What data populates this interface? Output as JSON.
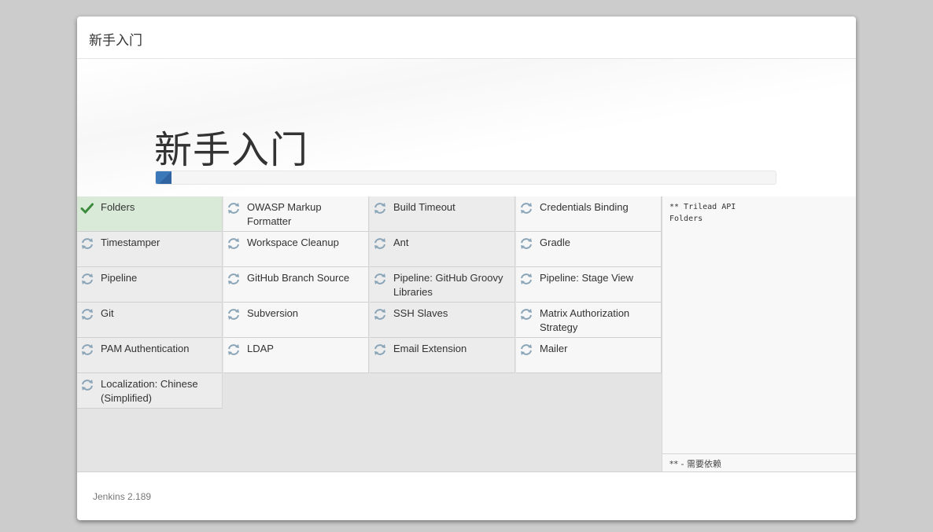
{
  "header": {
    "title": "新手入门"
  },
  "jumbotron": {
    "title": "新手入门",
    "progress_percent": 2.5
  },
  "plugins": [
    {
      "name": "Folders",
      "status": "success",
      "icon": "check-icon"
    },
    {
      "name": "OWASP Markup Formatter",
      "status": "pending",
      "icon": "refresh-icon"
    },
    {
      "name": "Build Timeout",
      "status": "pending",
      "icon": "refresh-icon"
    },
    {
      "name": "Credentials Binding",
      "status": "pending",
      "icon": "refresh-icon"
    },
    {
      "name": "Timestamper",
      "status": "pending",
      "icon": "refresh-icon"
    },
    {
      "name": "Workspace Cleanup",
      "status": "pending",
      "icon": "refresh-icon"
    },
    {
      "name": "Ant",
      "status": "pending",
      "icon": "refresh-icon"
    },
    {
      "name": "Gradle",
      "status": "pending",
      "icon": "refresh-icon"
    },
    {
      "name": "Pipeline",
      "status": "pending",
      "icon": "refresh-icon"
    },
    {
      "name": "GitHub Branch Source",
      "status": "pending",
      "icon": "refresh-icon"
    },
    {
      "name": "Pipeline: GitHub Groovy Libraries",
      "status": "pending",
      "icon": "refresh-icon"
    },
    {
      "name": "Pipeline: Stage View",
      "status": "pending",
      "icon": "refresh-icon"
    },
    {
      "name": "Git",
      "status": "pending",
      "icon": "refresh-icon"
    },
    {
      "name": "Subversion",
      "status": "pending",
      "icon": "refresh-icon"
    },
    {
      "name": "SSH Slaves",
      "status": "pending",
      "icon": "refresh-icon"
    },
    {
      "name": "Matrix Authorization Strategy",
      "status": "pending",
      "icon": "refresh-icon"
    },
    {
      "name": "PAM Authentication",
      "status": "pending",
      "icon": "refresh-icon"
    },
    {
      "name": "LDAP",
      "status": "pending",
      "icon": "refresh-icon"
    },
    {
      "name": "Email Extension",
      "status": "pending",
      "icon": "refresh-icon"
    },
    {
      "name": "Mailer",
      "status": "pending",
      "icon": "refresh-icon"
    },
    {
      "name": "Localization: Chinese (Simplified)",
      "status": "pending",
      "icon": "refresh-icon"
    }
  ],
  "log": {
    "lines": [
      "** Trilead API",
      "Folders"
    ],
    "legend": "** - 需要依赖"
  },
  "footer": {
    "version": "Jenkins 2.189"
  },
  "colors": {
    "success_bg": "#d9ebd8",
    "check": "#3d8b3d",
    "refresh": "#8aa4b8",
    "progress": "#3b78b8"
  }
}
